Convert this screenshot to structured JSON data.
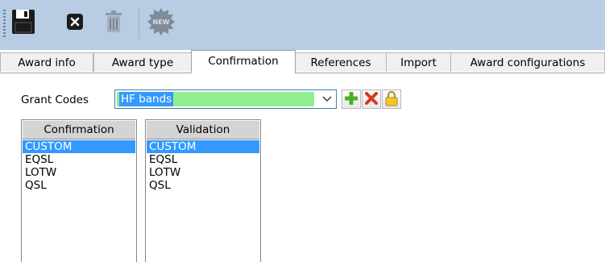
{
  "toolbar": {
    "buttons": [
      {
        "name": "save-icon"
      },
      {
        "name": "close-icon"
      },
      {
        "name": "trash-icon"
      },
      {
        "name": "new-badge-icon",
        "label": "NEW"
      }
    ]
  },
  "tabs": [
    {
      "label": "Award info"
    },
    {
      "label": "Award type"
    },
    {
      "label": "Confirmation",
      "active": true
    },
    {
      "label": "References"
    },
    {
      "label": "Import"
    },
    {
      "label": "Award configurations"
    }
  ],
  "grant": {
    "label": "Grant Codes",
    "value": "HF bands",
    "actions": [
      "add-icon",
      "delete-icon",
      "lock-icon"
    ]
  },
  "confirmation_list": {
    "header": "Confirmation",
    "items": [
      "CUSTOM",
      "EQSL",
      "LOTW",
      "QSL"
    ],
    "selected": "CUSTOM"
  },
  "validation_list": {
    "header": "Validation",
    "items": [
      "CUSTOM",
      "EQSL",
      "LOTW",
      "QSL"
    ],
    "selected": "CUSTOM"
  },
  "colors": {
    "toolbar_bg": "#b8cce4",
    "selection": "#3399ff",
    "combo_field": "#90ee90",
    "list_header": "#d4d4d4"
  }
}
